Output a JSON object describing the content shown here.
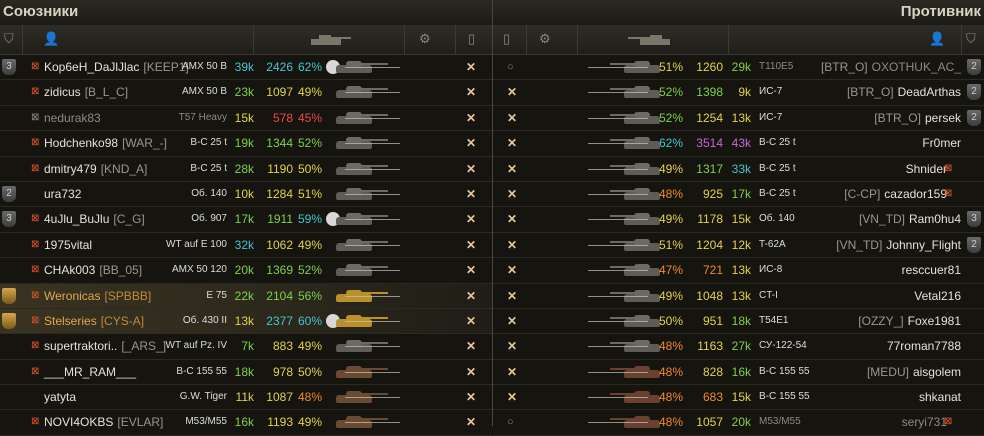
{
  "header": {
    "allies_title": "Союзники",
    "enemies_title": "Противник"
  },
  "colors": {
    "green": "#7fd14a",
    "yellow": "#e2d34a",
    "orange": "#f08a2c",
    "teal": "#46c4d0",
    "purple": "#c666e0",
    "red": "#f04848",
    "white": "#e6e2d6"
  },
  "allies": [
    {
      "badge": "3",
      "platoon": true,
      "name": "Kop6eH_DaJlJlac",
      "clan": "[KEEP1]",
      "vehicle": "AMX 50 B",
      "s1": "39k",
      "s1c": "teal",
      "s2": "2426",
      "s2c": "teal",
      "s3": "62%",
      "s3c": "teal",
      "medal": true,
      "tank": "gray",
      "dead": false,
      "hp": 0.6
    },
    {
      "badge": "",
      "platoon": true,
      "name": "zidicus",
      "clan": "[B_L_C]",
      "vehicle": "AMX 50 B",
      "s1": "23k",
      "s1c": "green",
      "s2": "1097",
      "s2c": "yellow",
      "s3": "49%",
      "s3c": "yellow",
      "medal": false,
      "tank": "gray",
      "dead": false,
      "hp": 0.55
    },
    {
      "badge": "",
      "platoon": true,
      "name": "nedurak83",
      "clan": "",
      "vehicle": "T57 Heavy",
      "s1": "15k",
      "s1c": "yellow",
      "s2": "578",
      "s2c": "red",
      "s3": "45%",
      "s3c": "red",
      "medal": false,
      "tank": "gray",
      "dead": true,
      "hp": 0.0
    },
    {
      "badge": "",
      "platoon": true,
      "name": "Hodchenko98",
      "clan": "[WAR_-]",
      "vehicle": "B-C 25 t",
      "s1": "19k",
      "s1c": "green",
      "s2": "1344",
      "s2c": "green",
      "s3": "52%",
      "s3c": "green",
      "medal": false,
      "tank": "gray",
      "dead": false,
      "hp": 0.0
    },
    {
      "badge": "",
      "platoon": true,
      "name": "dmitry479",
      "clan": "[KND_A]",
      "vehicle": "B-C 25 t",
      "s1": "28k",
      "s1c": "green",
      "s2": "1190",
      "s2c": "yellow",
      "s3": "50%",
      "s3c": "yellow",
      "medal": false,
      "tank": "gray",
      "dead": false,
      "hp": 0.0
    },
    {
      "badge": "2",
      "platoon": false,
      "name": "ura732",
      "clan": "",
      "vehicle": "Об. 140",
      "s1": "10k",
      "s1c": "yellow",
      "s2": "1284",
      "s2c": "yellow",
      "s3": "51%",
      "s3c": "yellow",
      "medal": false,
      "tank": "gray",
      "dead": false,
      "hp": 0.0
    },
    {
      "badge": "3",
      "platoon": true,
      "name": "4uJlu_BuJlu",
      "clan": "[C_G]",
      "vehicle": "Об. 907",
      "s1": "17k",
      "s1c": "green",
      "s2": "1911",
      "s2c": "green",
      "s3": "59%",
      "s3c": "teal",
      "medal": true,
      "tank": "gray",
      "dead": false,
      "hp": 0.0
    },
    {
      "badge": "",
      "platoon": true,
      "name": "1975vital",
      "clan": "",
      "vehicle": "WT auf E 100",
      "s1": "32k",
      "s1c": "teal",
      "s2": "1062",
      "s2c": "yellow",
      "s3": "49%",
      "s3c": "yellow",
      "medal": false,
      "tank": "gray",
      "dead": false,
      "hp": 0.0
    },
    {
      "badge": "",
      "platoon": true,
      "name": "CHAk003",
      "clan": "[BB_05]",
      "vehicle": "AMX 50 120",
      "s1": "20k",
      "s1c": "green",
      "s2": "1369",
      "s2c": "green",
      "s3": "52%",
      "s3c": "green",
      "medal": false,
      "tank": "gray",
      "dead": false,
      "hp": 0.0
    },
    {
      "badge": "G",
      "platoon": true,
      "name": "Weronicas",
      "clan": "[SPBBB]",
      "vehicle": "E 75",
      "s1": "22k",
      "s1c": "green",
      "s2": "2104",
      "s2c": "green",
      "s3": "56%",
      "s3c": "green",
      "medal": false,
      "tank": "gold",
      "dead": false,
      "hp": 0.0,
      "highlight": true
    },
    {
      "badge": "G",
      "platoon": true,
      "name": "Stelseries",
      "clan": "[CYS-A]",
      "vehicle": "Об. 430 II",
      "s1": "13k",
      "s1c": "yellow",
      "s2": "2377",
      "s2c": "teal",
      "s3": "60%",
      "s3c": "teal",
      "medal": true,
      "tank": "gold",
      "dead": false,
      "hp": 0.0,
      "highlight": true,
      "player": true
    },
    {
      "badge": "",
      "platoon": true,
      "name": "supertraktori..",
      "clan": "[_ARS_]",
      "vehicle": "WT auf Pz. IV",
      "s1": "7k",
      "s1c": "green",
      "s2": "883",
      "s2c": "yellow",
      "s3": "49%",
      "s3c": "yellow",
      "medal": false,
      "tank": "gray",
      "dead": false,
      "hp": 0.0
    },
    {
      "badge": "",
      "platoon": true,
      "name": "___MR_RAM___",
      "clan": "",
      "vehicle": "B-C 155 55",
      "s1": "18k",
      "s1c": "green",
      "s2": "978",
      "s2c": "yellow",
      "s3": "50%",
      "s3c": "yellow",
      "medal": false,
      "tank": "rust",
      "dead": false,
      "hp": 0.0
    },
    {
      "badge": "",
      "platoon": false,
      "name": "yatyta",
      "clan": "",
      "vehicle": "G.W. Tiger",
      "s1": "11k",
      "s1c": "yellow",
      "s2": "1087",
      "s2c": "yellow",
      "s3": "48%",
      "s3c": "orange",
      "medal": false,
      "tank": "rust",
      "dead": false,
      "hp": 0.0
    },
    {
      "badge": "",
      "platoon": true,
      "name": "NOVI4OKBS",
      "clan": "[EVLAR]",
      "vehicle": "M53/M55",
      "s1": "16k",
      "s1c": "green",
      "s2": "1193",
      "s2c": "yellow",
      "s3": "49%",
      "s3c": "yellow",
      "medal": false,
      "tank": "rust",
      "dead": false,
      "hp": 0.0
    }
  ],
  "enemies": [
    {
      "badge": "2",
      "platoon": false,
      "name": "OXOTHUK_AC_",
      "clan": "[BTR_O]",
      "vehicle": "T110E5",
      "s1": "29k",
      "s1c": "green",
      "s2": "1260",
      "s2c": "yellow",
      "s3": "51%",
      "s3c": "yellow",
      "dead": true,
      "killed": false,
      "tank": "gray"
    },
    {
      "badge": "2",
      "platoon": false,
      "name": "DeadArthas",
      "clan": "[BTR_O]",
      "vehicle": "ИС-7",
      "s1": "9k",
      "s1c": "yellow",
      "s2": "1398",
      "s2c": "green",
      "s3": "52%",
      "s3c": "green",
      "dead": false,
      "killed": true,
      "tank": "gray"
    },
    {
      "badge": "2",
      "platoon": false,
      "name": "persek",
      "clan": "[BTR_O]",
      "vehicle": "ИС-7",
      "s1": "13k",
      "s1c": "yellow",
      "s2": "1254",
      "s2c": "yellow",
      "s3": "52%",
      "s3c": "green",
      "dead": false,
      "killed": true,
      "tank": "gray"
    },
    {
      "badge": "",
      "platoon": false,
      "name": "Fr0mer",
      "clan": "",
      "vehicle": "B-C 25 t",
      "s1": "43k",
      "s1c": "purple",
      "s2": "3514",
      "s2c": "purple",
      "s3": "62%",
      "s3c": "teal",
      "dead": false,
      "killed": true,
      "tank": "gray"
    },
    {
      "badge": "",
      "platoon": true,
      "name": "Shnider",
      "clan": "",
      "vehicle": "B-C 25 t",
      "s1": "33k",
      "s1c": "teal",
      "s2": "1317",
      "s2c": "green",
      "s3": "49%",
      "s3c": "yellow",
      "dead": false,
      "killed": true,
      "tank": "gray"
    },
    {
      "badge": "",
      "platoon": true,
      "name": "cazador159",
      "clan": "[C-CP]",
      "vehicle": "B-C 25 t",
      "s1": "17k",
      "s1c": "green",
      "s2": "925",
      "s2c": "yellow",
      "s3": "48%",
      "s3c": "orange",
      "dead": false,
      "killed": true,
      "tank": "gray"
    },
    {
      "badge": "3",
      "platoon": false,
      "name": "Ram0hu4",
      "clan": "[VN_TD]",
      "vehicle": "Об. 140",
      "s1": "15k",
      "s1c": "yellow",
      "s2": "1178",
      "s2c": "yellow",
      "s3": "49%",
      "s3c": "yellow",
      "dead": false,
      "killed": true,
      "tank": "gray"
    },
    {
      "badge": "2",
      "platoon": false,
      "name": "Johnny_Flight",
      "clan": "[VN_TD]",
      "vehicle": "T-62A",
      "s1": "12k",
      "s1c": "yellow",
      "s2": "1204",
      "s2c": "yellow",
      "s3": "51%",
      "s3c": "yellow",
      "dead": false,
      "killed": true,
      "tank": "gray"
    },
    {
      "badge": "",
      "platoon": false,
      "name": "resccuer81",
      "clan": "",
      "vehicle": "ИС-8",
      "s1": "13k",
      "s1c": "yellow",
      "s2": "721",
      "s2c": "orange",
      "s3": "47%",
      "s3c": "orange",
      "dead": false,
      "killed": true,
      "tank": "gray"
    },
    {
      "badge": "",
      "platoon": false,
      "name": "Vetal216",
      "clan": "",
      "vehicle": "CT-I",
      "s1": "13k",
      "s1c": "yellow",
      "s2": "1048",
      "s2c": "yellow",
      "s3": "49%",
      "s3c": "yellow",
      "dead": false,
      "killed": true,
      "tank": "gray"
    },
    {
      "badge": "",
      "platoon": false,
      "name": "Foxe1981",
      "clan": "[OZZY_]",
      "vehicle": "T54E1",
      "s1": "18k",
      "s1c": "green",
      "s2": "951",
      "s2c": "yellow",
      "s3": "50%",
      "s3c": "yellow",
      "dead": false,
      "killed": true,
      "tank": "gray"
    },
    {
      "badge": "",
      "platoon": false,
      "name": "77roman7788",
      "clan": "",
      "vehicle": "СУ-122-54",
      "s1": "27k",
      "s1c": "green",
      "s2": "1163",
      "s2c": "yellow",
      "s3": "48%",
      "s3c": "orange",
      "dead": false,
      "killed": true,
      "tank": "gray"
    },
    {
      "badge": "",
      "platoon": false,
      "name": "aisgolem",
      "clan": "[MEDU]",
      "vehicle": "B-C 155 55",
      "s1": "16k",
      "s1c": "green",
      "s2": "828",
      "s2c": "yellow",
      "s3": "48%",
      "s3c": "orange",
      "dead": false,
      "killed": true,
      "tank": "red"
    },
    {
      "badge": "",
      "platoon": false,
      "name": "shkanat",
      "clan": "",
      "vehicle": "B-C 155 55",
      "s1": "15k",
      "s1c": "yellow",
      "s2": "683",
      "s2c": "orange",
      "s3": "48%",
      "s3c": "orange",
      "dead": false,
      "killed": true,
      "tank": "red"
    },
    {
      "badge": "",
      "platoon": true,
      "name": "seryi731",
      "clan": "",
      "vehicle": "M53/M55",
      "s1": "20k",
      "s1c": "green",
      "s2": "1057",
      "s2c": "yellow",
      "s3": "48%",
      "s3c": "orange",
      "dead": true,
      "killed": false,
      "tank": "red"
    }
  ]
}
